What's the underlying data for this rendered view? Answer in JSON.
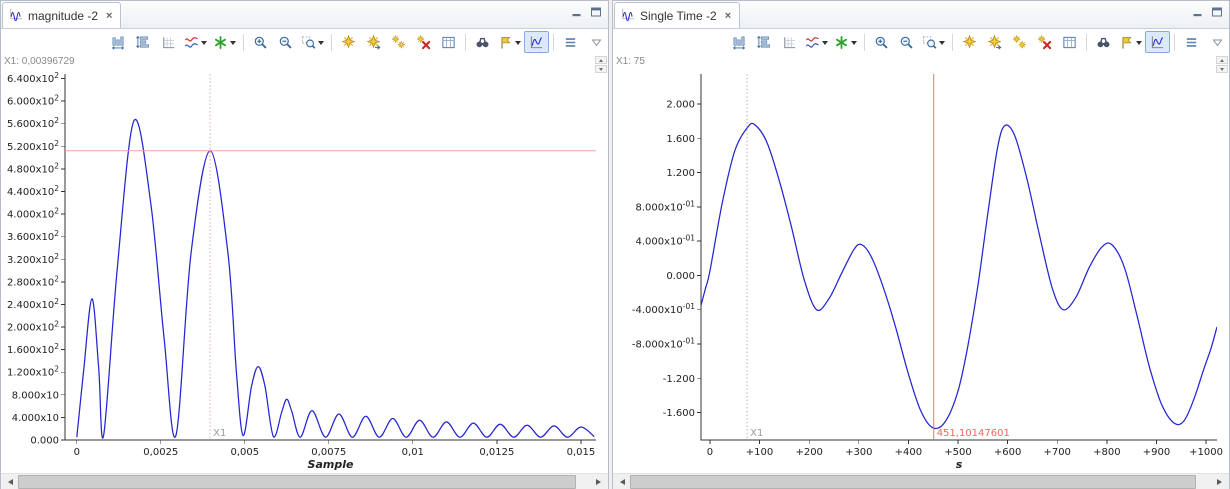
{
  "panels": [
    {
      "tab": {
        "title": "magnitude -2",
        "close": "×"
      }
    },
    {
      "tab": {
        "title": "Single Time -2",
        "close": "×"
      }
    }
  ],
  "toolbar": {
    "buttons": [
      {
        "name": "adjust-time-axis",
        "icon": "fitx"
      },
      {
        "name": "adjust-value-axis",
        "icon": "fity"
      },
      {
        "name": "axis-settings",
        "icon": "grid"
      },
      {
        "name": "series-format",
        "icon": "color",
        "dropdown": true
      },
      {
        "name": "add-series",
        "icon": "star",
        "dropdown": true
      },
      {
        "sep": true
      },
      {
        "name": "zoom-in",
        "icon": "zoomin"
      },
      {
        "name": "zoom-out",
        "icon": "zoomout"
      },
      {
        "name": "zoom-selection",
        "icon": "zoomsel",
        "dropdown": true
      },
      {
        "sep": true
      },
      {
        "name": "add-cursor",
        "icon": "gold1"
      },
      {
        "name": "move-cursor",
        "icon": "gold2"
      },
      {
        "name": "couple-cursors",
        "icon": "gold3"
      },
      {
        "name": "remove-cursors",
        "icon": "goldx"
      },
      {
        "name": "show-data-table",
        "icon": "table"
      },
      {
        "sep": true
      },
      {
        "name": "search",
        "icon": "binoc"
      },
      {
        "name": "go-to-marker",
        "icon": "flag",
        "dropdown": true
      },
      {
        "name": "toggle-crosshair",
        "icon": "cross",
        "selected": true
      },
      {
        "sep": true
      },
      {
        "name": "show-legend",
        "icon": "legend"
      }
    ]
  },
  "chart_data": [
    {
      "type": "line",
      "title": "magnitude -2",
      "xlabel": "Sample",
      "ylabel": "",
      "grid": false,
      "legend": false,
      "xlim": [
        -0.00035,
        0.01545
      ],
      "ylim": [
        0,
        648
      ],
      "x_ticks": [
        [
          0,
          "0"
        ],
        [
          0.0025,
          "0,0025"
        ],
        [
          0.005,
          "0,005"
        ],
        [
          0.0075,
          "0,0075"
        ],
        [
          0.01,
          "0,01"
        ],
        [
          0.0125,
          "0,0125"
        ],
        [
          0.015,
          "0,015"
        ]
      ],
      "y_ticks": [
        [
          640,
          "6.400x10^2"
        ],
        [
          600,
          "6.000x10^2"
        ],
        [
          560,
          "5.600x10^2"
        ],
        [
          520,
          "5.200x10^2"
        ],
        [
          480,
          "4.800x10^2"
        ],
        [
          440,
          "4.400x10^2"
        ],
        [
          400,
          "4.000x10^2"
        ],
        [
          360,
          "3.600x10^2"
        ],
        [
          320,
          "3.200x10^2"
        ],
        [
          280,
          "2.800x10^2"
        ],
        [
          240,
          "2.400x10^2"
        ],
        [
          200,
          "2.000x10^2"
        ],
        [
          160,
          "1.600x10^2"
        ],
        [
          120,
          "1.200x10^2"
        ],
        [
          80,
          "8.000x10"
        ],
        [
          40,
          "4.000x10"
        ],
        [
          0,
          "0.000"
        ]
      ],
      "series": [
        {
          "name": "magnitude",
          "color": "#2525d2",
          "points": [
            [
              0.0,
              5
            ],
            [
              0.0002,
              120
            ],
            [
              0.00045,
              250
            ],
            [
              0.00065,
              130
            ],
            [
              0.0008,
              8
            ],
            [
              0.0012,
              300
            ],
            [
              0.0017,
              565
            ],
            [
              0.0022,
              420
            ],
            [
              0.0026,
              180
            ],
            [
              0.00295,
              8
            ],
            [
              0.0034,
              330
            ],
            [
              0.00397,
              512
            ],
            [
              0.0045,
              330
            ],
            [
              0.00475,
              120
            ],
            [
              0.00495,
              8
            ],
            [
              0.0052,
              95
            ],
            [
              0.0054,
              130
            ],
            [
              0.0056,
              95
            ],
            [
              0.00585,
              6
            ],
            [
              0.0061,
              50
            ],
            [
              0.00625,
              72
            ],
            [
              0.0064,
              50
            ],
            [
              0.00665,
              5
            ],
            [
              0.007,
              52
            ],
            [
              0.0074,
              5
            ],
            [
              0.0078,
              46
            ],
            [
              0.0082,
              5
            ],
            [
              0.0086,
              42
            ],
            [
              0.009,
              5
            ],
            [
              0.0094,
              38
            ],
            [
              0.0098,
              5
            ],
            [
              0.0102,
              35
            ],
            [
              0.0106,
              5
            ],
            [
              0.011,
              32
            ],
            [
              0.0114,
              5
            ],
            [
              0.0118,
              30
            ],
            [
              0.0122,
              5
            ],
            [
              0.0126,
              28
            ],
            [
              0.013,
              5
            ],
            [
              0.0134,
              26
            ],
            [
              0.0138,
              5
            ],
            [
              0.0142,
              25
            ],
            [
              0.0146,
              5
            ],
            [
              0.015,
              23
            ],
            [
              0.0154,
              6
            ]
          ]
        }
      ],
      "cursors": {
        "h_lines": [
          {
            "y": 512,
            "color": "#f2a2a2",
            "style": "solid"
          }
        ],
        "v_lines": [
          {
            "x": 0.00396729,
            "label": "X1",
            "style": "dotted",
            "color": "#e2a6a6",
            "label_color": "#9b9b9b"
          }
        ]
      },
      "readout": "X1: 0,00396729"
    },
    {
      "type": "line",
      "title": "Single Time -2",
      "xlabel": "s",
      "ylabel": "",
      "grid": false,
      "legend": false,
      "xlim": [
        -18,
        1022
      ],
      "ylim": [
        -1.92,
        2.35
      ],
      "x_ticks": [
        [
          0,
          "0"
        ],
        [
          100,
          "+100"
        ],
        [
          200,
          "+200"
        ],
        [
          300,
          "+300"
        ],
        [
          400,
          "+400"
        ],
        [
          500,
          "+500"
        ],
        [
          600,
          "+600"
        ],
        [
          700,
          "+700"
        ],
        [
          800,
          "+800"
        ],
        [
          900,
          "+900"
        ],
        [
          1000,
          "+1000"
        ]
      ],
      "y_ticks": [
        [
          2,
          "2.000"
        ],
        [
          1.6,
          "1.600"
        ],
        [
          1.2,
          "1.200"
        ],
        [
          0.8,
          "8.000x10^-01"
        ],
        [
          0.4,
          "4.000x10^-01"
        ],
        [
          0,
          "0.000"
        ],
        [
          -0.4,
          "-4.000x10^-01"
        ],
        [
          -0.8,
          "-8.000x10^-01"
        ],
        [
          -1.2,
          "-1.200"
        ],
        [
          -1.6,
          "-1.600"
        ]
      ],
      "series": [
        {
          "name": "Single Time",
          "color": "#2525d2",
          "points": [
            [
              -18,
              -0.35
            ],
            [
              -9,
              -0.15
            ],
            [
              0,
              0.05
            ],
            [
              25,
              0.85
            ],
            [
              50,
              1.45
            ],
            [
              75,
              1.72
            ],
            [
              90,
              1.76
            ],
            [
              115,
              1.55
            ],
            [
              140,
              1.1
            ],
            [
              165,
              0.55
            ],
            [
              190,
              -0.05
            ],
            [
              215,
              -0.4
            ],
            [
              240,
              -0.27
            ],
            [
              265,
              0.02
            ],
            [
              290,
              0.3
            ],
            [
              305,
              0.36
            ],
            [
              325,
              0.22
            ],
            [
              350,
              -0.15
            ],
            [
              375,
              -0.62
            ],
            [
              400,
              -1.15
            ],
            [
              425,
              -1.58
            ],
            [
              450,
              -1.78
            ],
            [
              475,
              -1.7
            ],
            [
              500,
              -1.35
            ],
            [
              520,
              -0.82
            ],
            [
              540,
              -0.12
            ],
            [
              560,
              0.72
            ],
            [
              580,
              1.5
            ],
            [
              595,
              1.75
            ],
            [
              615,
              1.62
            ],
            [
              640,
              1.1
            ],
            [
              665,
              0.45
            ],
            [
              690,
              -0.15
            ],
            [
              712,
              -0.4
            ],
            [
              738,
              -0.25
            ],
            [
              765,
              0.1
            ],
            [
              790,
              0.33
            ],
            [
              810,
              0.36
            ],
            [
              835,
              0.1
            ],
            [
              860,
              -0.45
            ],
            [
              885,
              -1.05
            ],
            [
              910,
              -1.5
            ],
            [
              935,
              -1.72
            ],
            [
              955,
              -1.7
            ],
            [
              975,
              -1.45
            ],
            [
              995,
              -1.1
            ],
            [
              1010,
              -0.85
            ],
            [
              1022,
              -0.6
            ]
          ]
        }
      ],
      "cursors": {
        "h_lines": [],
        "v_lines": [
          {
            "x": 75,
            "label": "X1",
            "style": "dotted",
            "color": "#b2b2b2",
            "label_color": "#9b9b9b"
          },
          {
            "x": 451.10147601,
            "label": "451,10147601",
            "style": "solid",
            "color": "#ff6a6a",
            "label_color": "#f06a5a"
          }
        ]
      },
      "readout": "X1: 75"
    }
  ]
}
